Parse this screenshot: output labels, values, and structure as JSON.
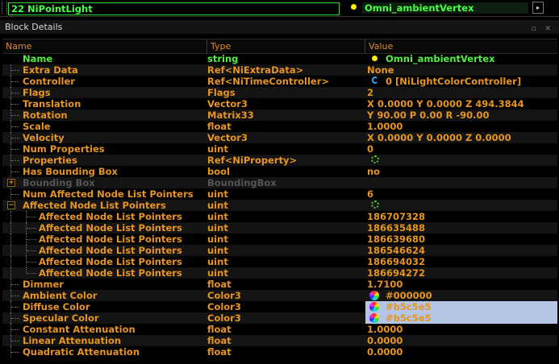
{
  "topbar": {
    "node_label": "22 NiPointLight",
    "node_name": "Omni_ambientVertex",
    "arrow_glyph": "▸"
  },
  "panel": {
    "title": "Block Details",
    "title_icons": "▫ ✕"
  },
  "columns": {
    "name": "Name",
    "type": "Type",
    "value": "Value"
  },
  "rows": [
    {
      "name": "Name",
      "type": "string",
      "value": "Omni_ambientVertex",
      "style": "green",
      "icon": "bullet-icon",
      "indent": 0
    },
    {
      "name": "Extra Data",
      "type": "Ref<NiExtraData>",
      "value": "None",
      "indent": 0,
      "branch": true
    },
    {
      "name": "Controller",
      "type": "Ref<NiTimeController>",
      "value": "0 [NiLightColorController]",
      "icon": "ref-icon",
      "indent": 0,
      "branch": true
    },
    {
      "name": "Flags",
      "type": "Flags",
      "value": "2",
      "indent": 0,
      "branch": true
    },
    {
      "name": "Translation",
      "type": "Vector3",
      "value": "X 0.0000 Y 0.0000 Z 494.3844",
      "indent": 0,
      "branch": true
    },
    {
      "name": "Rotation",
      "type": "Matrix33",
      "value": "Y 90.00 P 0.00 R -90.00",
      "indent": 0,
      "branch": true
    },
    {
      "name": "Scale",
      "type": "float",
      "value": "1.0000",
      "indent": 0,
      "branch": true
    },
    {
      "name": "Velocity",
      "type": "Vector3",
      "value": "X 0.0000 Y 0.0000 Z 0.0000",
      "indent": 0,
      "branch": true
    },
    {
      "name": "Num Properties",
      "type": "uint",
      "value": "0",
      "indent": 0,
      "branch": true
    },
    {
      "name": "Properties",
      "type": "Ref<NiProperty>",
      "value": "",
      "icon": "refresh-icon",
      "indent": 0,
      "branch": true
    },
    {
      "name": "Has Bounding Box",
      "type": "bool",
      "value": "no",
      "indent": 0,
      "branch": true
    },
    {
      "name": "Bounding Box",
      "type": "BoundingBox",
      "value": "",
      "style": "disabled",
      "indent": 0,
      "expander": "+"
    },
    {
      "name": "Num Affected Node List Pointers",
      "type": "uint",
      "value": "6",
      "indent": 0,
      "branch": true
    },
    {
      "name": "Affected Node List Pointers",
      "type": "uint",
      "value": "",
      "icon": "refresh-icon",
      "indent": 0,
      "expander": "−"
    },
    {
      "name": "Affected Node List Pointers",
      "type": "uint",
      "value": "186707328",
      "indent": 1
    },
    {
      "name": "Affected Node List Pointers",
      "type": "uint",
      "value": "186635488",
      "indent": 1
    },
    {
      "name": "Affected Node List Pointers",
      "type": "uint",
      "value": "186639680",
      "indent": 1
    },
    {
      "name": "Affected Node List Pointers",
      "type": "uint",
      "value": "186546624",
      "indent": 1
    },
    {
      "name": "Affected Node List Pointers",
      "type": "uint",
      "value": "186694032",
      "indent": 1
    },
    {
      "name": "Affected Node List Pointers",
      "type": "uint",
      "value": "186694272",
      "indent": 1,
      "last_child": true
    },
    {
      "name": "Dimmer",
      "type": "float",
      "value": "1.7100",
      "indent": 0,
      "branch": true
    },
    {
      "name": "Ambient Color",
      "type": "Color3",
      "value": "#000000",
      "icon": "color-wheel-icon",
      "indent": 0,
      "branch": true
    },
    {
      "name": "Diffuse Color",
      "type": "Color3",
      "value": "#b5c5e5",
      "icon": "color-wheel-icon",
      "indent": 0,
      "branch": true,
      "swatch": "#b5c5e5"
    },
    {
      "name": "Specular Color",
      "type": "Color3",
      "value": "#b5c5e5",
      "icon": "color-wheel-icon",
      "indent": 0,
      "branch": true,
      "swatch": "#b5c5e5"
    },
    {
      "name": "Constant Attenuation",
      "type": "float",
      "value": "1.0000",
      "indent": 0,
      "branch": true
    },
    {
      "name": "Linear Attenuation",
      "type": "float",
      "value": "0.0000",
      "indent": 0,
      "branch": true
    },
    {
      "name": "Quadratic Attenuation",
      "type": "float",
      "value": "0.0000",
      "indent": 0,
      "branch": true
    }
  ],
  "colors": {
    "accent_orange": "#e69520",
    "accent_green": "#55ee44",
    "disabled_gray": "#555555"
  }
}
